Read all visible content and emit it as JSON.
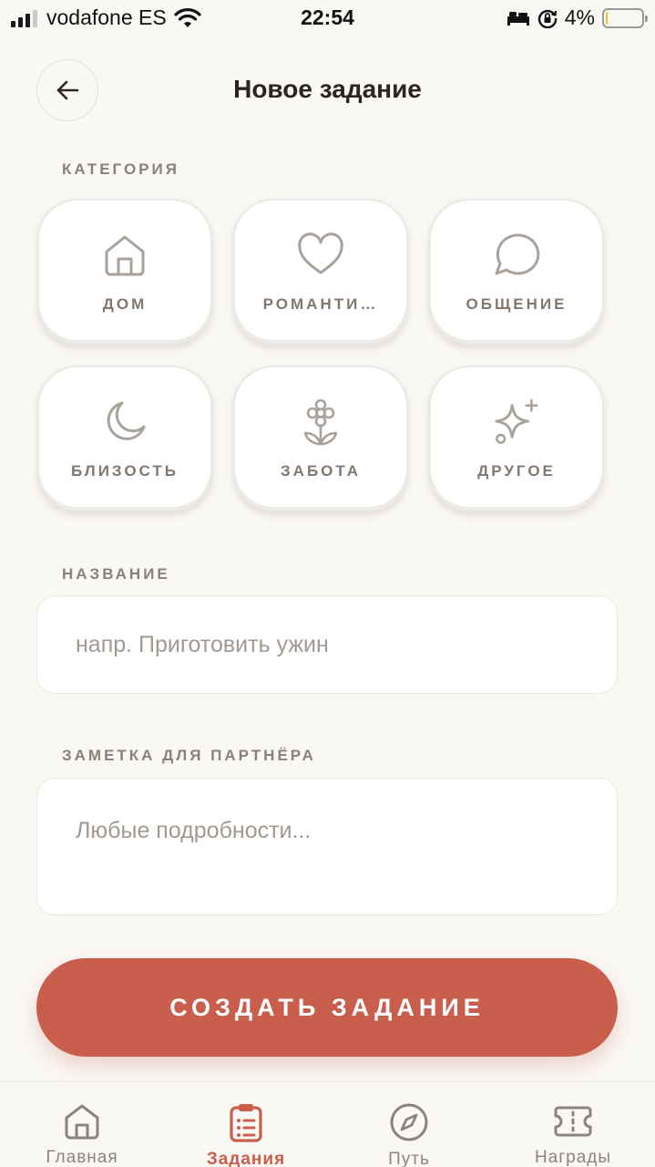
{
  "status_bar": {
    "carrier": "vodafone ES",
    "time": "22:54",
    "battery_percent": "4%",
    "battery_level": 0.04,
    "signal_bars": 3,
    "icons": [
      "signal-icon",
      "wifi-icon",
      "sleep-mode-icon",
      "orientation-lock-icon",
      "battery-icon"
    ]
  },
  "header": {
    "title": "Новое задание",
    "back_icon": "arrow-left-icon"
  },
  "category": {
    "label": "КАТЕГОРИЯ",
    "items": [
      {
        "label": "ДОМ",
        "icon": "house-icon"
      },
      {
        "label": "РОМАНТИ…",
        "icon": "heart-icon"
      },
      {
        "label": "ОБЩЕНИЕ",
        "icon": "chat-bubble-icon"
      },
      {
        "label": "БЛИЗОСТЬ",
        "icon": "moon-icon"
      },
      {
        "label": "ЗАБОТА",
        "icon": "flower-icon"
      },
      {
        "label": "ДРУГОЕ",
        "icon": "sparkles-icon"
      }
    ]
  },
  "title_field": {
    "label": "НАЗВАНИЕ",
    "placeholder": "напр. Приготовить ужин",
    "value": ""
  },
  "note_field": {
    "label": "ЗАМЕТКА ДЛЯ ПАРТНЁРА",
    "placeholder": "Любые подробности...",
    "value": ""
  },
  "create_button": {
    "label": "СОЗДАТЬ ЗАДАНИЕ"
  },
  "bottom_nav": {
    "items": [
      {
        "label": "Главная",
        "icon": "home-icon",
        "active": false
      },
      {
        "label": "Задания",
        "icon": "clipboard-icon",
        "active": true
      },
      {
        "label": "Путь",
        "icon": "compass-icon",
        "active": false
      },
      {
        "label": "Награды",
        "icon": "ticket-icon",
        "active": false
      }
    ]
  },
  "colors": {
    "accent": "#c85e4b",
    "background": "#faf8f5",
    "muted_text": "#8a8178",
    "icon_stroke": "#a8a29b"
  }
}
